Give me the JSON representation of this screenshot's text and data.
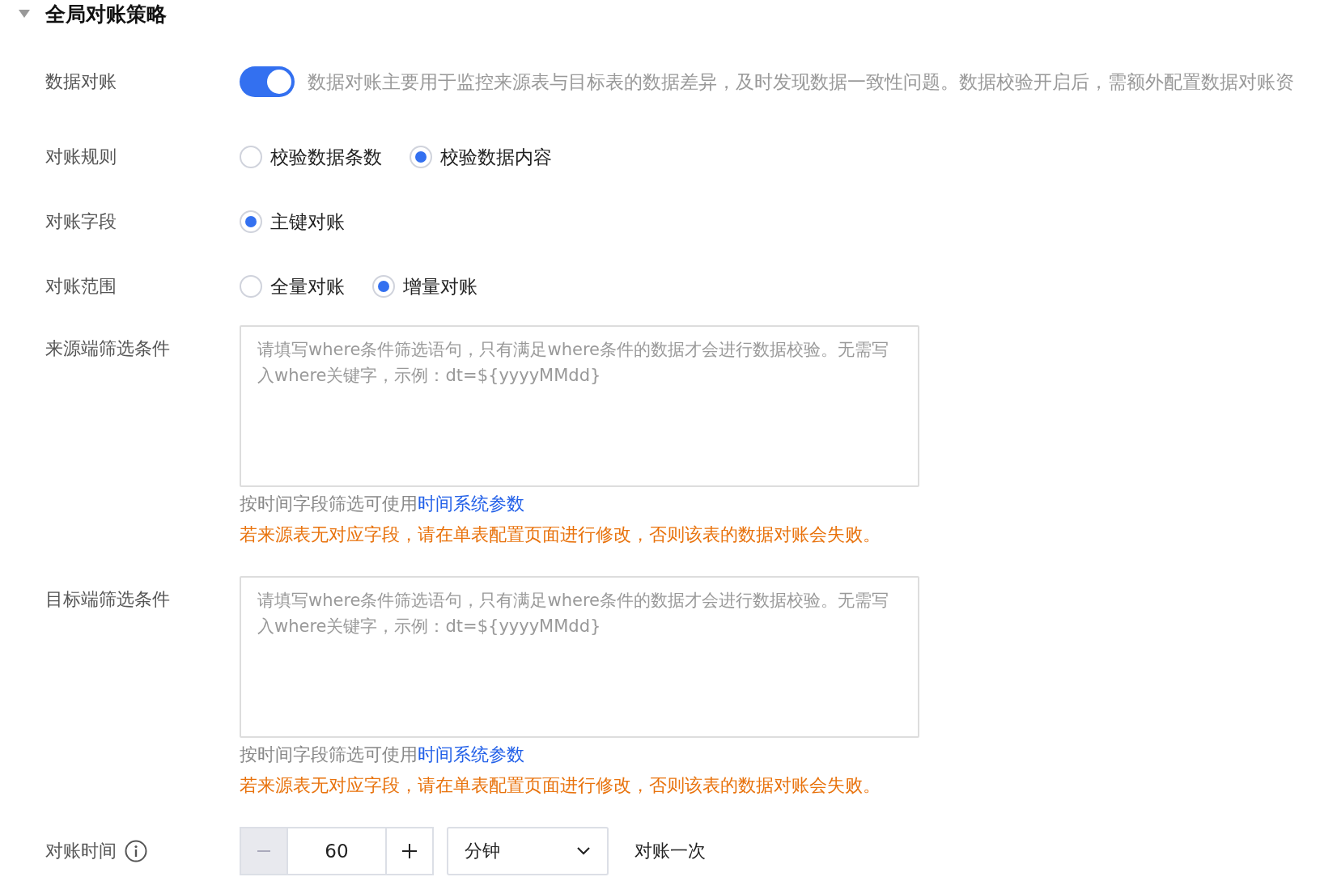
{
  "section": {
    "title": "全局对账策略",
    "expanded": true
  },
  "toggle_row": {
    "label": "数据对账",
    "on": true,
    "description": "数据对账主要用于监控来源表与目标表的数据差异，及时发现数据一致性问题。数据校验开启后，需额外配置数据对账资"
  },
  "radio_groups": [
    {
      "label": "对账规则",
      "options": [
        {
          "label": "校验数据条数",
          "selected": false
        },
        {
          "label": "校验数据内容",
          "selected": true
        }
      ]
    },
    {
      "label": "对账字段",
      "options": [
        {
          "label": "主键对账",
          "selected": true
        }
      ]
    },
    {
      "label": "对账范围",
      "options": [
        {
          "label": "全量对账",
          "selected": false
        },
        {
          "label": "增量对账",
          "selected": true
        }
      ]
    }
  ],
  "filters": [
    {
      "label": "来源端筛选条件",
      "placeholder": "请填写where条件筛选语句，只有满足where条件的数据才会进行数据校验。无需写入where关键字，示例：dt=${yyyyMMdd}",
      "hint": "按时间字段筛选可使用",
      "hint_link": "时间系统参数",
      "warning": "若来源表无对应字段，请在单表配置页面进行修改，否则该表的数据对账会失败。"
    },
    {
      "label": "目标端筛选条件",
      "placeholder": "请填写where条件筛选语句，只有满足where条件的数据才会进行数据校验。无需写入where关键字，示例：dt=${yyyyMMdd}",
      "hint": "按时间字段筛选可使用",
      "hint_link": "时间系统参数",
      "warning": "若来源表无对应字段，请在单表配置页面进行修改，否则该表的数据对账会失败。"
    }
  ],
  "schedule": {
    "label": "对账时间",
    "decrement_disabled": true,
    "value": "60",
    "unit": "分钟",
    "suffix": "对账一次"
  }
}
